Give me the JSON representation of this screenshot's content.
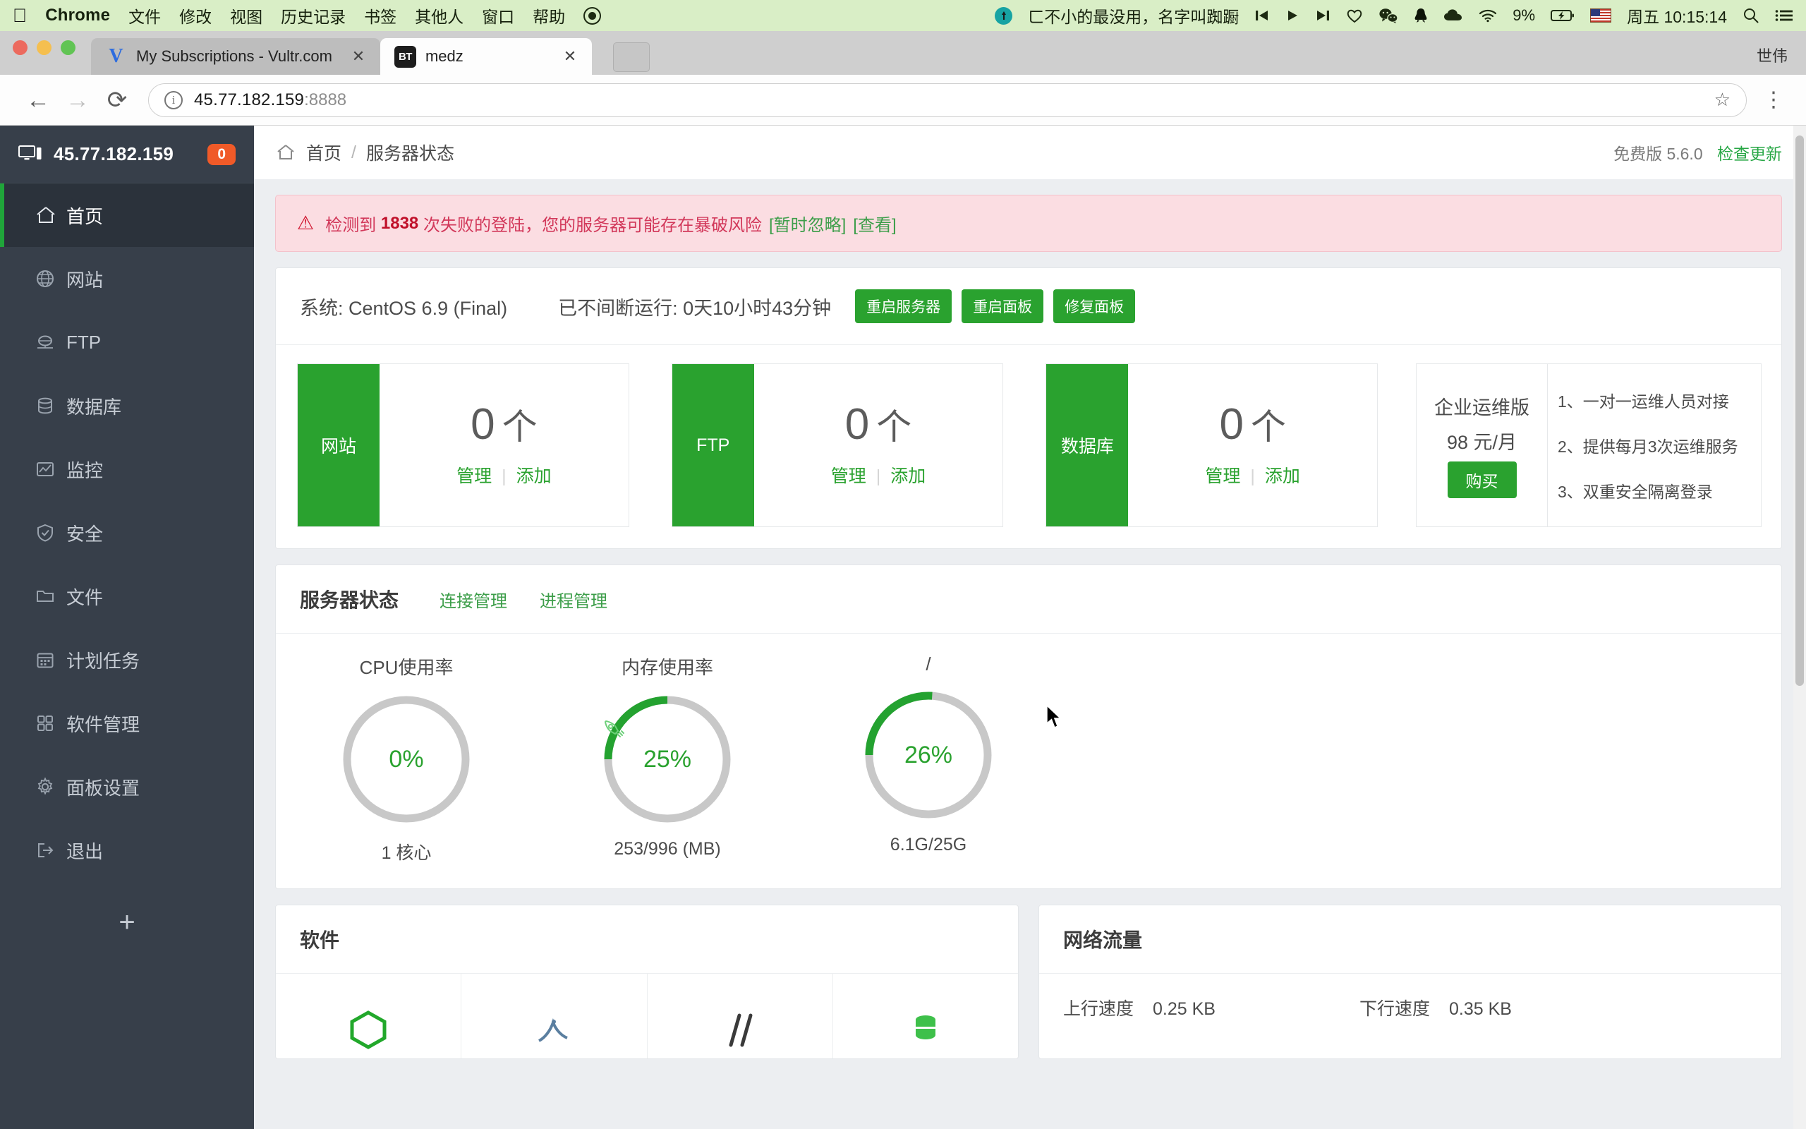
{
  "menubar": {
    "apple_icon": "apple-icon",
    "app_name": "Chrome",
    "items": [
      "文件",
      "修改",
      "视图",
      "历史记录",
      "书签",
      "其他人",
      "窗口",
      "帮助"
    ],
    "status": {
      "record_icon": "record-icon",
      "tunnel_icon": "tunnel-icon",
      "nickname": "ㄈ不小的最没用，名字叫踟蹰",
      "prev_icon": "previous-track-icon",
      "play_icon": "play-icon",
      "next_icon": "next-track-icon",
      "heart_icon": "heart-icon",
      "wechat_icon": "wechat-icon",
      "qq_icon": "qq-icon",
      "cloud_icon": "cloud-icon",
      "wifi_icon": "wifi-icon",
      "battery_percent": "9%",
      "battery_icon": "battery-charging-icon",
      "flag_icon": "us-flag-icon",
      "clock": "周五 10:15:14",
      "search_icon": "search-icon",
      "controlcenter_icon": "list-menu-icon"
    }
  },
  "browser": {
    "window_user": "世伟",
    "tabs": [
      {
        "title": "My Subscriptions - Vultr.com",
        "favicon": "vultr-icon",
        "active": false,
        "close": "✕"
      },
      {
        "title": "medz",
        "favicon": "bt-icon",
        "active": true,
        "close": "✕"
      }
    ],
    "new_tab_label": "",
    "nav": {
      "back": "←",
      "forward": "→",
      "reload": "⟳"
    },
    "address": {
      "host": "45.77.182.159",
      "port": ":8888",
      "info_icon": "info-icon",
      "star_icon": "bookmark-star-icon"
    },
    "menu_icon": "kebab-menu-icon"
  },
  "sidebar": {
    "server_ip": "45.77.182.159",
    "badge": "0",
    "monitor_icon": "computer-icon",
    "items": [
      {
        "label": "首页",
        "icon": "home-icon",
        "active": true
      },
      {
        "label": "网站",
        "icon": "globe-icon",
        "active": false
      },
      {
        "label": "FTP",
        "icon": "ftp-icon",
        "active": false
      },
      {
        "label": "数据库",
        "icon": "database-icon",
        "active": false
      },
      {
        "label": "监控",
        "icon": "chart-icon",
        "active": false
      },
      {
        "label": "安全",
        "icon": "shield-icon",
        "active": false
      },
      {
        "label": "文件",
        "icon": "folder-icon",
        "active": false
      },
      {
        "label": "计划任务",
        "icon": "calendar-icon",
        "active": false
      },
      {
        "label": "软件管理",
        "icon": "grid-icon",
        "active": false
      },
      {
        "label": "面板设置",
        "icon": "gear-icon",
        "active": false
      },
      {
        "label": "退出",
        "icon": "logout-icon",
        "active": false
      }
    ],
    "add_label": "+"
  },
  "breadcrumb": {
    "home_icon": "home-icon",
    "home": "首页",
    "separator": "/",
    "current": "服务器状态",
    "version": "免费版 5.6.0",
    "check_update": "检查更新"
  },
  "alert": {
    "icon": "warning-triangle-icon",
    "prefix": "检测到",
    "count": "1838",
    "message": "次失败的登陆，您的服务器可能存在暴破风险",
    "ignore_link": "[暂时忽略]",
    "view_link": "[查看]"
  },
  "system": {
    "os_label": "系统: CentOS 6.9 (Final)",
    "uptime_label": "已不间断运行: 0天10小时43分钟",
    "buttons": [
      "重启服务器",
      "重启面板",
      "修复面板"
    ]
  },
  "stats": [
    {
      "tab": "网站",
      "count": "0",
      "unit": "个",
      "manage": "管理",
      "add": "添加"
    },
    {
      "tab": "FTP",
      "count": "0",
      "unit": "个",
      "manage": "管理",
      "add": "添加"
    },
    {
      "tab": "数据库",
      "count": "0",
      "unit": "个",
      "manage": "管理",
      "add": "添加"
    }
  ],
  "promo": {
    "title": "企业运维版",
    "price": "98 元/月",
    "buy": "购买",
    "features": [
      "1、一对一运维人员对接",
      "2、提供每月3次运维服务",
      "3、双重安全隔离登录"
    ]
  },
  "server_status": {
    "title": "服务器状态",
    "links": [
      "连接管理",
      "进程管理"
    ]
  },
  "chart_data": {
    "type": "pie",
    "title": "服务器状态",
    "gauges": [
      {
        "label": "CPU使用率",
        "value": 0,
        "display": "0%",
        "sub": "1 核心",
        "icon": null
      },
      {
        "label": "内存使用率",
        "value": 25,
        "display": "25%",
        "sub": "253/996 (MB)",
        "icon": "rocket-icon"
      },
      {
        "label": "/",
        "value": 26,
        "display": "26%",
        "sub": "6.1G/25G",
        "icon": null
      }
    ],
    "track_color": "#c8c8c8",
    "fill_color": "#24a230",
    "ylim": [
      0,
      100
    ]
  },
  "software": {
    "title": "软件",
    "icons": [
      "nginx-icon",
      "mysql-icon",
      "php-icon",
      "ftp-server-icon"
    ]
  },
  "network": {
    "title": "网络流量",
    "up_label": "上行速度",
    "up_value": "0.25 KB",
    "down_label": "下行速度",
    "down_value": "0.35 KB"
  },
  "colors": {
    "accent_green": "#2aa22f",
    "sidebar_bg": "#373f4a",
    "alert_bg": "#fbdde2",
    "badge_orange": "#f05a28"
  }
}
